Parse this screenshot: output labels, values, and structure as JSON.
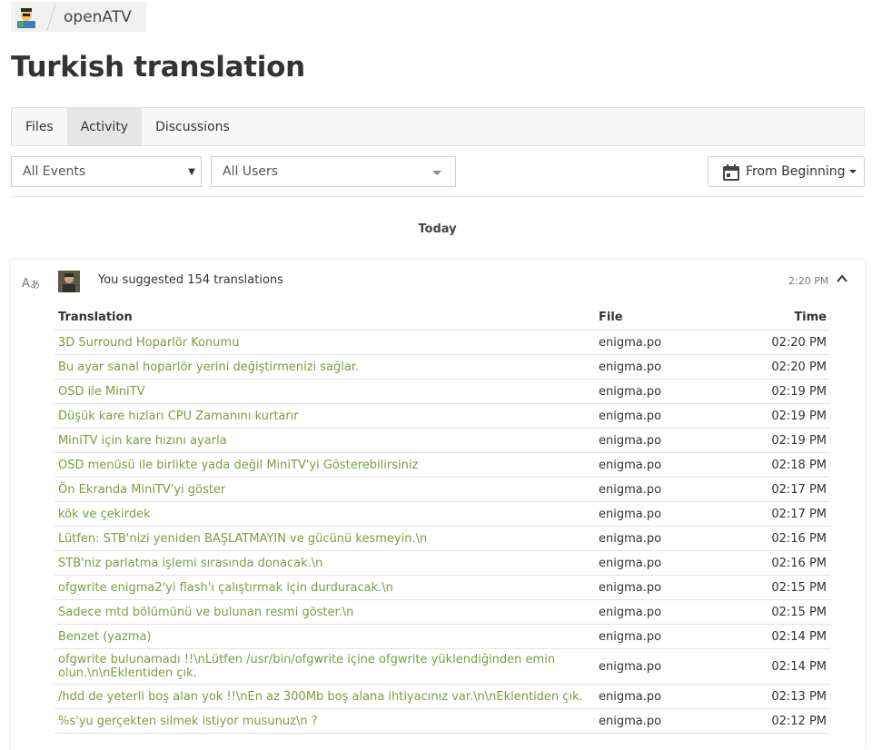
{
  "breadcrumb": {
    "project": "openATV"
  },
  "page": {
    "title": "Turkish translation"
  },
  "tabs": [
    {
      "label": "Files",
      "active": false
    },
    {
      "label": "Activity",
      "active": true
    },
    {
      "label": "Discussions",
      "active": false
    }
  ],
  "filters": {
    "events": "All Events",
    "users": "All Users",
    "date": "From Beginning"
  },
  "day_label": "Today",
  "activity": {
    "summary": "You suggested 154 translations",
    "time": "2:20 PM",
    "columns": {
      "translation": "Translation",
      "file": "File",
      "time": "Time"
    },
    "rows": [
      {
        "text": "3D Surround Hoparlör Konumu",
        "file": "enigma.po",
        "time": "02:20 PM"
      },
      {
        "text": "Bu ayar sanal hoparlör yerini değiştirmenizi sağlar.",
        "file": "enigma.po",
        "time": "02:20 PM"
      },
      {
        "text": "OSD ile MiniTV",
        "file": "enigma.po",
        "time": "02:19 PM"
      },
      {
        "text": "Düşük kare hızları CPU Zamanını kurtarır",
        "file": "enigma.po",
        "time": "02:19 PM"
      },
      {
        "text": "MiniTV için kare hızını ayarla",
        "file": "enigma.po",
        "time": "02:19 PM"
      },
      {
        "text": "OSD menüsü ile birlikte yada değil MiniTV'yi Gösterebilirsiniz",
        "file": "enigma.po",
        "time": "02:18 PM"
      },
      {
        "text": "Ön Ekranda MiniTV'yi göster",
        "file": "enigma.po",
        "time": "02:17 PM"
      },
      {
        "text": "kök ve çekirdek",
        "file": "enigma.po",
        "time": "02:17 PM"
      },
      {
        "text": "Lütfen: STB'nizi yeniden BAŞLATMAYIN ve gücünü kesmeyin.\\n",
        "file": "enigma.po",
        "time": "02:16 PM"
      },
      {
        "text": "STB'niz parlatma işlemi sırasında donacak.\\n",
        "file": "enigma.po",
        "time": "02:16 PM"
      },
      {
        "text": "ofgwrite enigma2'yi flash'ı çalıştırmak için durduracak.\\n",
        "file": "enigma.po",
        "time": "02:15 PM"
      },
      {
        "text": "Sadece mtd bölümünü ve bulunan resmi göster.\\n",
        "file": "enigma.po",
        "time": "02:15 PM"
      },
      {
        "text": "Benzet (yazma)",
        "file": "enigma.po",
        "time": "02:14 PM"
      },
      {
        "text": "ofgwrite bulunamadı !!\\nLütfen /usr/bin/ofgwrite içine ofgwrite yüklendiğinden emin olun.\\n\\nEklentiden çık.",
        "file": "enigma.po",
        "time": "02:14 PM"
      },
      {
        "text": "/hdd de yeterli boş alan yok !!\\nEn az 300Mb boş alana ihtiyacınız var.\\n\\nEklentiden çık.",
        "file": "enigma.po",
        "time": "02:13 PM"
      },
      {
        "text": "%s'yu gerçekten silmek istiyor musunuz\\n ?",
        "file": "enigma.po",
        "time": "02:12 PM"
      }
    ]
  },
  "colors": {
    "link": "#7a9e3d",
    "tab_active_bg": "#e6e6e6"
  },
  "icons": [
    "app-logo-icon",
    "translate-icon",
    "calendar-icon",
    "chevron-up-icon",
    "user-avatar"
  ]
}
